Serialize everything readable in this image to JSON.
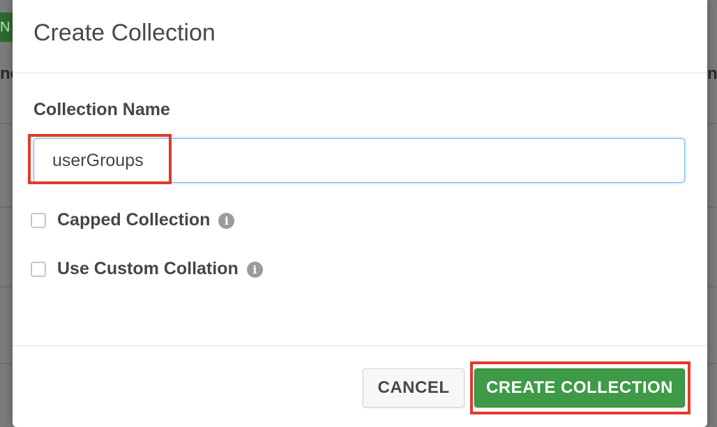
{
  "background": {
    "left_button_glyph": "N",
    "left_edge_text": "ne",
    "right_edge_text": "n"
  },
  "dialog": {
    "title": "Create Collection",
    "name_field": {
      "label": "Collection Name",
      "value": "userGroups",
      "placeholder": ""
    },
    "options": [
      {
        "label": "Capped Collection",
        "checked": false,
        "info_icon": "info-icon"
      },
      {
        "label": "Use Custom Collation",
        "checked": false,
        "info_icon": "info-icon"
      }
    ],
    "buttons": {
      "cancel_label": "CANCEL",
      "create_label": "CREATE COLLECTION"
    }
  },
  "colors": {
    "primary_green": "#3f9a47",
    "highlight_red": "#e23a2a",
    "focus_blue": "#6fb3f0"
  }
}
